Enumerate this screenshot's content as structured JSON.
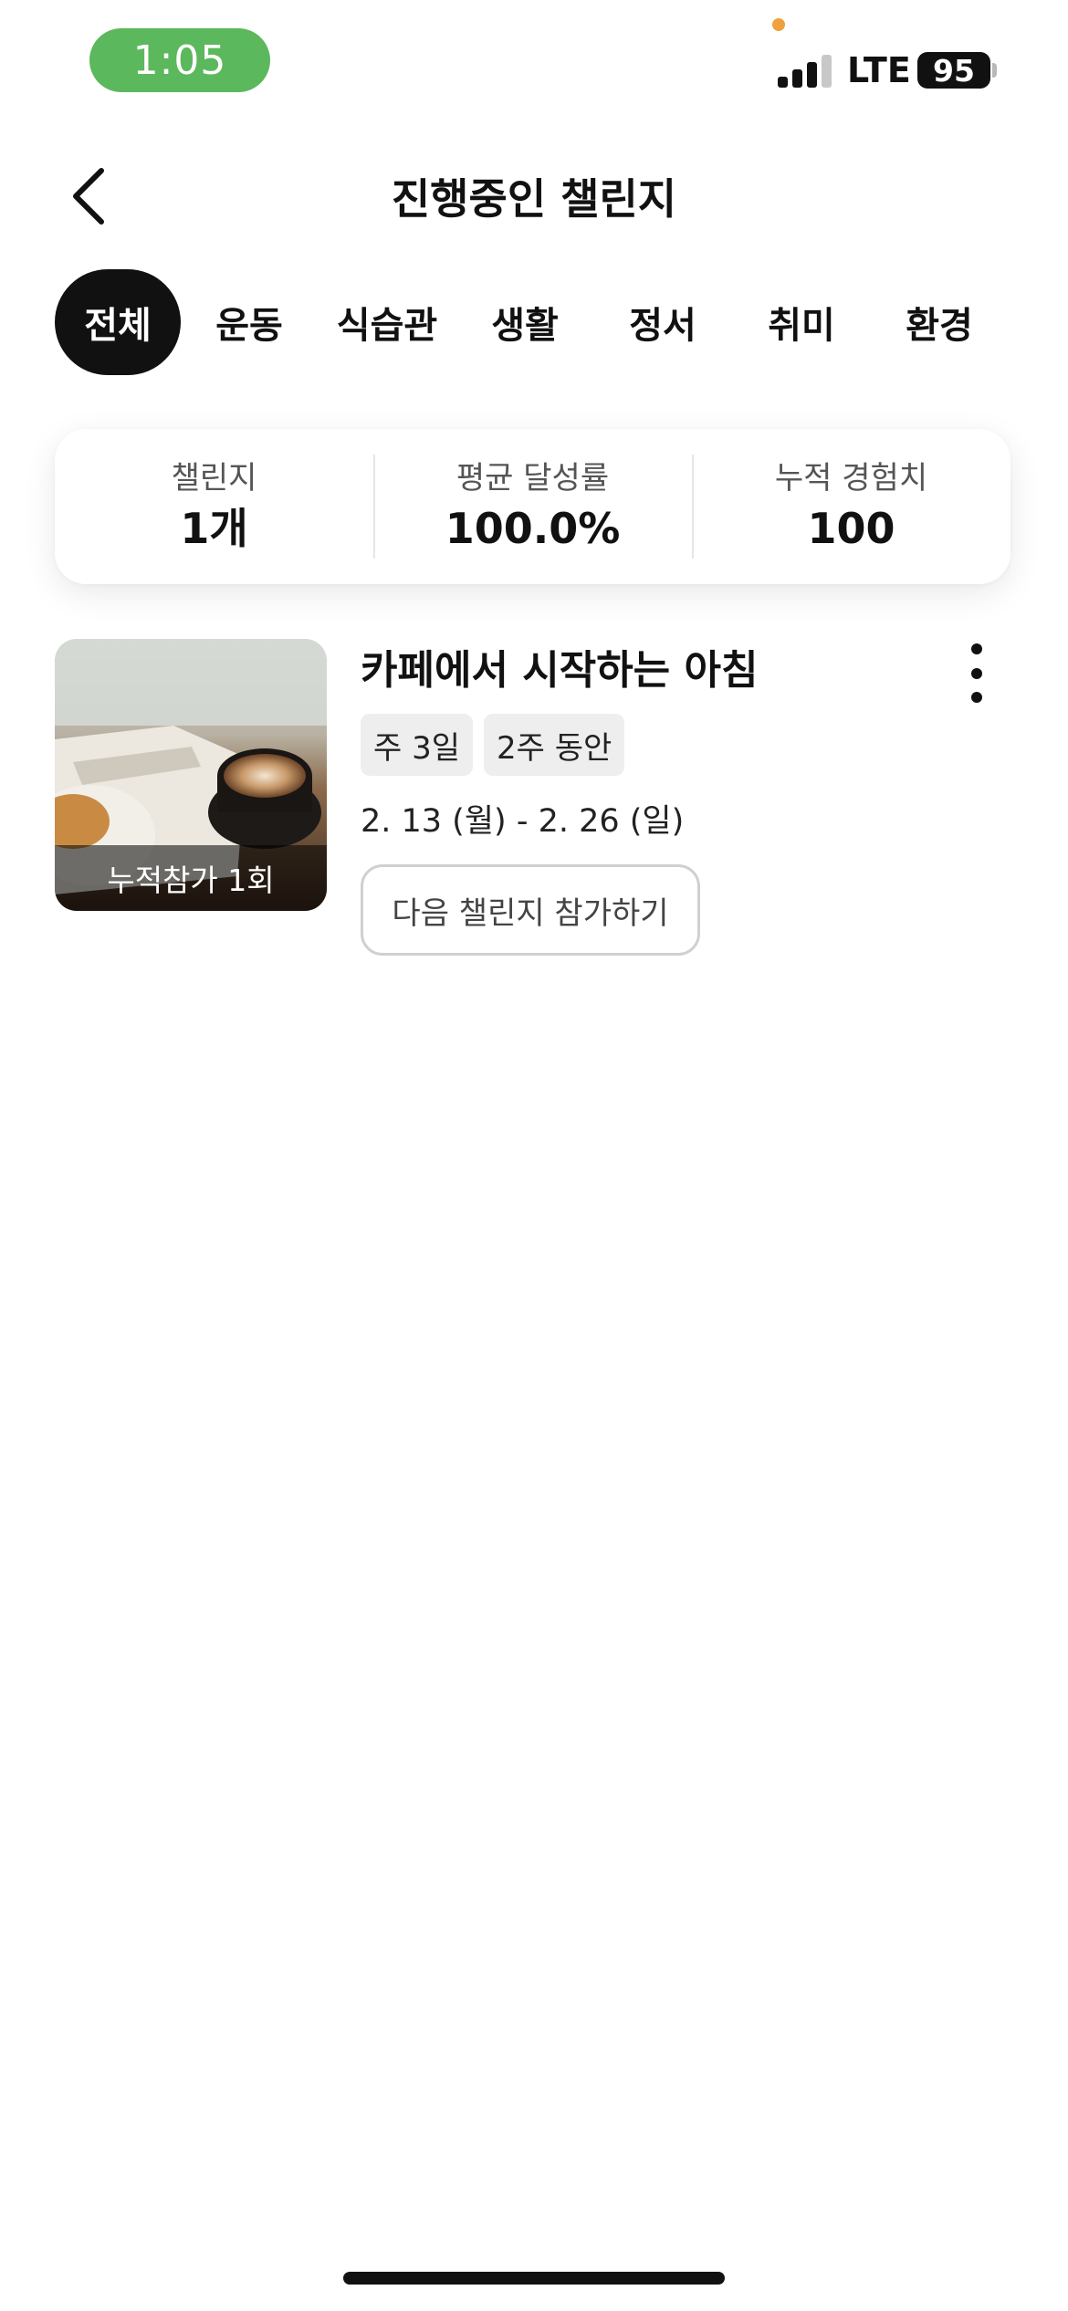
{
  "status_bar": {
    "time": "1:05",
    "carrier": "LTE",
    "battery": "95"
  },
  "header": {
    "title": "진행중인 챌린지",
    "back_icon": "chevron-left-icon"
  },
  "tabs": [
    {
      "label": "전체",
      "active": true
    },
    {
      "label": "운동",
      "active": false
    },
    {
      "label": "식습관",
      "active": false
    },
    {
      "label": "생활",
      "active": false
    },
    {
      "label": "정서",
      "active": false
    },
    {
      "label": "취미",
      "active": false
    },
    {
      "label": "환경",
      "active": false
    }
  ],
  "stats": [
    {
      "label": "챌린지",
      "value": "1개"
    },
    {
      "label": "평균 달성률",
      "value": "100.0%"
    },
    {
      "label": "누적 경험치",
      "value": "100"
    }
  ],
  "challenges": [
    {
      "title": "카페에서 시작하는 아침",
      "thumbnail_caption": "누적참가 1회",
      "chips": [
        "주 3일",
        "2주 동안"
      ],
      "date_range": "2. 13 (월) - 2. 26 (일)",
      "action_label": "다음 챌린지 참가하기",
      "more_icon": "more-vertical-icon"
    }
  ],
  "colors": {
    "time_pill": "#5cb85c",
    "active_tab": "#111111",
    "privacy_dot": "#f0a03c"
  }
}
